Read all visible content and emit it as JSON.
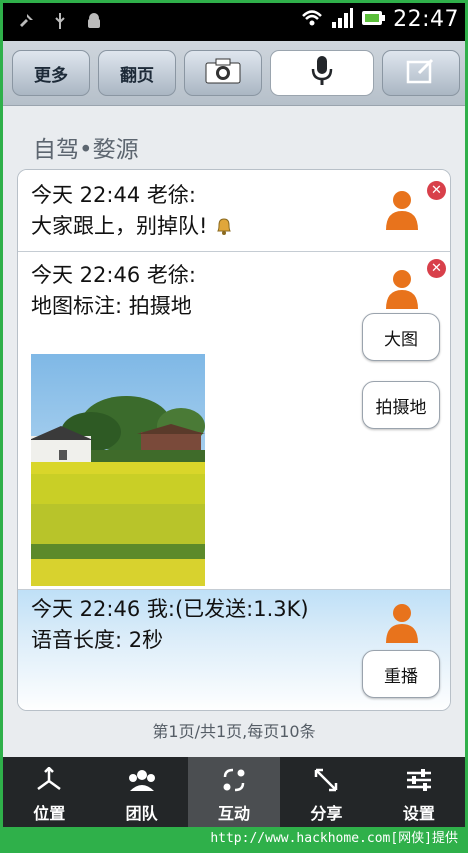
{
  "status_bar": {
    "time": "22:47"
  },
  "toolbar": {
    "more": "更多",
    "page": "翻页",
    "camera": "camera-icon",
    "mic": "microphone-icon",
    "compose": "compose-icon"
  },
  "header": {
    "title": "自驾•婺源"
  },
  "messages": [
    {
      "line1": "今天 22:44 老徐:",
      "line2": "大家跟上，别掉队!"
    },
    {
      "line1": "今天 22:46 老徐:",
      "line2": "地图标注: 拍摄地",
      "btn1": "大图",
      "btn2": "拍摄地"
    },
    {
      "line1": "今天 22:46 我:(已发送:1.3K)",
      "line2": "语音长度: 2秒",
      "btn1": "重播"
    }
  ],
  "pager": "第1页/共1页,每页10条",
  "nav": [
    {
      "label": "位置"
    },
    {
      "label": "团队"
    },
    {
      "label": "互动"
    },
    {
      "label": "分享"
    },
    {
      "label": "设置"
    }
  ],
  "footer": "http://www.hackhome.com[网侠]提供"
}
